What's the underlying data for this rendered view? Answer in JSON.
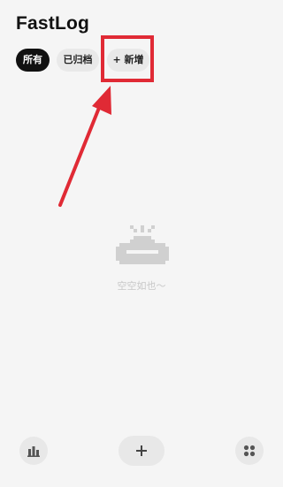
{
  "app": {
    "title": "FastLog"
  },
  "filters": [
    {
      "label": "所有",
      "selected": true
    },
    {
      "label": "已归档",
      "selected": false
    }
  ],
  "add_chip": {
    "label": "+ 新增"
  },
  "empty_state": {
    "icon": "empty-tray-icon",
    "text": "空空如也～"
  },
  "bottom_bar": {
    "stats_icon": "bar-chart-icon",
    "add_icon": "plus-icon",
    "menu_icon": "grid-dots-icon"
  },
  "annotation": {
    "color": "#e02a35"
  },
  "colors": {
    "background": "#f5f5f5",
    "accent": "#111111"
  }
}
